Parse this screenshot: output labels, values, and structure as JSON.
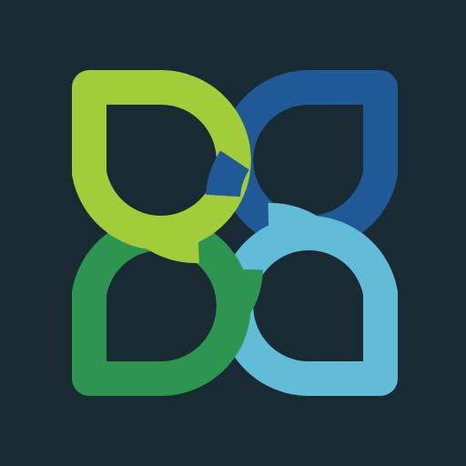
{
  "logo": {
    "name": "interlocking-four-petal-logo",
    "background_color": "#1a2a32",
    "petals": [
      {
        "name": "top-left",
        "color": "#a3cc3a",
        "corner": "top-left"
      },
      {
        "name": "top-right",
        "color": "#1f5a96",
        "corner": "top-right"
      },
      {
        "name": "bottom-left",
        "color": "#2d9550",
        "corner": "bottom-left"
      },
      {
        "name": "bottom-right",
        "color": "#62bcd8",
        "corner": "bottom-right"
      }
    ]
  }
}
